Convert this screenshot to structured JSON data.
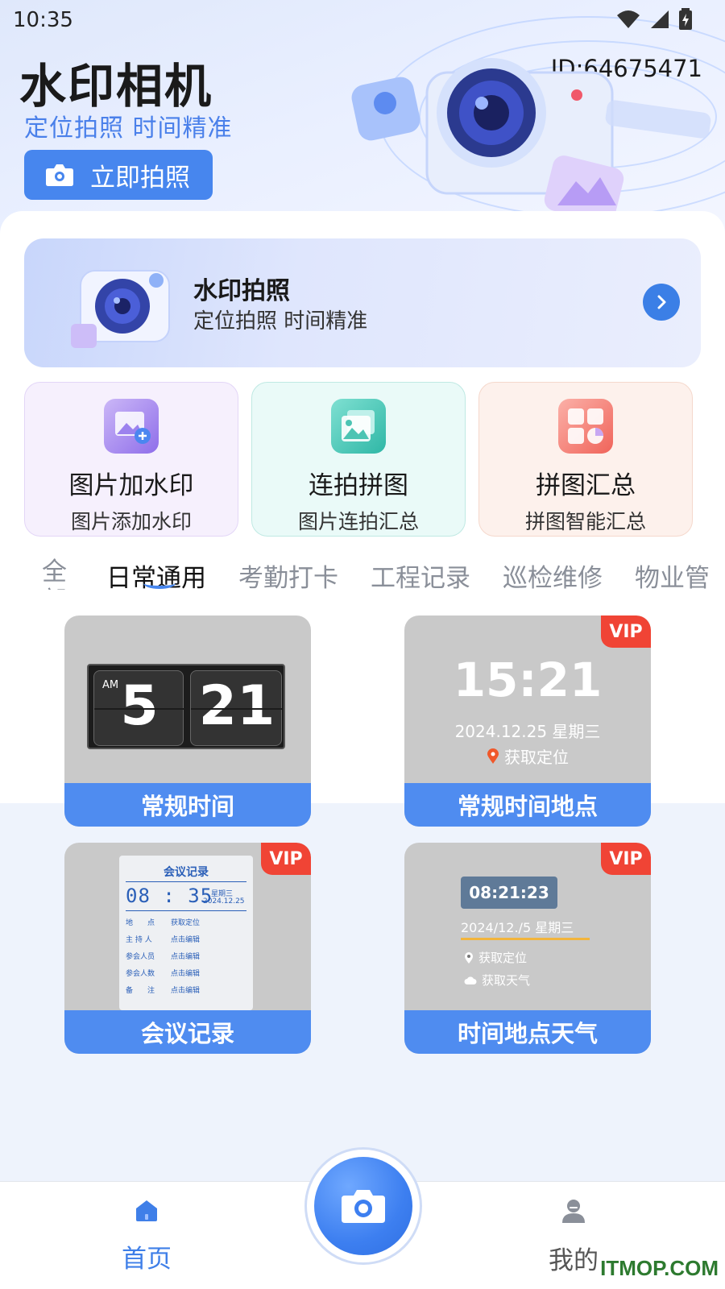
{
  "status_bar": {
    "time": "10:35"
  },
  "header": {
    "app_title": "水印相机",
    "subtitle": "定位拍照  时间精准",
    "shoot_button": "立即拍照",
    "user_id": "ID:64675471"
  },
  "banner": {
    "title": "水印拍照",
    "subtitle": "定位拍照 时间精准"
  },
  "features": [
    {
      "title": "图片加水印",
      "subtitle": "图片添加水印"
    },
    {
      "title": "连拍拼图",
      "subtitle": "图片连拍汇总"
    },
    {
      "title": "拼图汇总",
      "subtitle": "拼图智能汇总"
    }
  ],
  "tabs": {
    "items": [
      "全部",
      "日常通用",
      "考勤打卡",
      "工程记录",
      "巡检维修",
      "物业管"
    ],
    "active_index": 1
  },
  "templates": [
    {
      "label": "常规时间",
      "vip": false,
      "preview": {
        "ampm": "AM",
        "hour": "5",
        "minute": "21"
      }
    },
    {
      "label": "常规时间地点",
      "vip": true,
      "vip_text": "VIP",
      "preview": {
        "time": "15:21",
        "date": "2024.12.25 星期三",
        "location": "获取定位"
      }
    },
    {
      "label": "会议记录",
      "vip": true,
      "vip_text": "VIP",
      "preview": {
        "title": "会议记录",
        "time": "08 : 35",
        "weekday": "星期三",
        "date": "2024.12.25",
        "rows": [
          {
            "key": "地　　点",
            "value": "获取定位"
          },
          {
            "key": "主 持 人",
            "value": "点击编辑"
          },
          {
            "key": "参会人员",
            "value": "点击编辑"
          },
          {
            "key": "参会人数",
            "value": "点击编辑"
          },
          {
            "key": "备　　注",
            "value": "点击编辑"
          }
        ]
      }
    },
    {
      "label": "时间地点天气",
      "vip": true,
      "vip_text": "VIP",
      "preview": {
        "time": "08:21:23",
        "date": "2024/12./5 星期三",
        "location": "获取定位",
        "weather": "获取天气"
      }
    }
  ],
  "bottom_nav": {
    "home": "首页",
    "me": "我的"
  },
  "watermark": "ITMOP.COM",
  "colors": {
    "accent": "#4786ee",
    "label_bar": "#4f8cf0",
    "vip": "#f04435"
  }
}
